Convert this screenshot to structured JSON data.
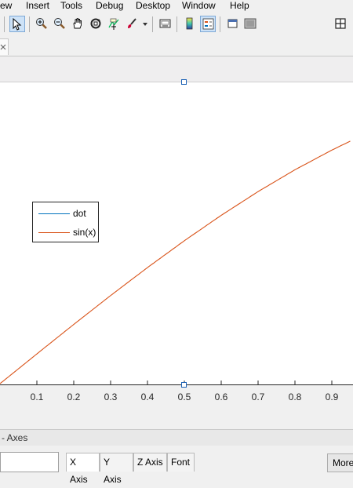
{
  "menu": {
    "items": [
      "ew",
      "Insert",
      "Tools",
      "Debug",
      "Desktop",
      "Window",
      "Help"
    ]
  },
  "toolbar": {
    "icons": [
      "select-arrow",
      "zoom-in",
      "zoom-out",
      "pan-hand",
      "rotate-3d",
      "data-cursor",
      "brush",
      "print-preview",
      "colorbar",
      "legend",
      "hide-plot-tools",
      "show-plot-tools",
      "dock"
    ],
    "active": [
      "select-arrow",
      "legend"
    ]
  },
  "chart_data": {
    "type": "line",
    "x_ticks": [
      "0.1",
      "0.2",
      "0.3",
      "0.4",
      "0.5",
      "0.6",
      "0.7",
      "0.8",
      "0.9"
    ],
    "xlim": [
      0,
      0.95
    ],
    "legend": [
      "dot",
      "sin(x)"
    ],
    "legend_position": "left",
    "series": [
      {
        "name": "dot",
        "color": "#0072bd",
        "x": [],
        "y": []
      },
      {
        "name": "sin(x)",
        "color": "#d95319",
        "x": [
          0,
          0.1,
          0.2,
          0.3,
          0.4,
          0.5,
          0.6,
          0.7,
          0.8,
          0.9,
          0.95
        ],
        "y": [
          0,
          0.0998,
          0.1987,
          0.2955,
          0.3894,
          0.4794,
          0.5646,
          0.6442,
          0.7174,
          0.7833,
          0.8134
        ]
      }
    ]
  },
  "inspector": {
    "title": "- Axes",
    "tabs": [
      "X Axis",
      "Y Axis",
      "Z Axis",
      "Font"
    ],
    "more_label": "More"
  },
  "colors": {
    "selection": "#1e63b6",
    "axes": "#262626"
  }
}
